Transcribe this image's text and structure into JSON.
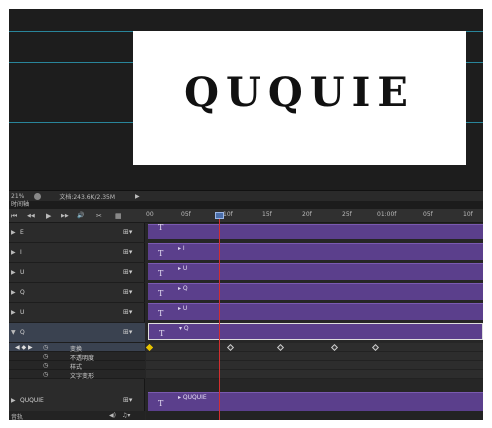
{
  "canvas": {
    "word": "QUQUIE"
  },
  "status": {
    "zoom": "21%",
    "doc_info": "文档:243.6K/2.35M"
  },
  "timeline": {
    "title": "时间轴",
    "controls": [
      "⏮",
      "◀◀",
      "▶",
      "▶▶",
      "🔊",
      "✂",
      "▦"
    ],
    "ticks": [
      "00",
      "05f",
      "10f",
      "15f",
      "20f",
      "25f",
      "01:00f",
      "05f",
      "10f"
    ]
  },
  "layers": [
    {
      "name": "E",
      "clip_label": ""
    },
    {
      "name": "I",
      "clip_label": "I"
    },
    {
      "name": "U",
      "clip_label": "U"
    },
    {
      "name": "Q",
      "clip_label": "Q"
    },
    {
      "name": "U",
      "clip_label": "U"
    },
    {
      "name": "Q",
      "clip_label": "Q",
      "expanded": true
    }
  ],
  "properties": [
    {
      "name": "变换",
      "keyframes": [
        0,
        0.24,
        0.39,
        0.55,
        0.67
      ]
    },
    {
      "name": "不透明度"
    },
    {
      "name": "样式"
    },
    {
      "name": "文字变形"
    }
  ],
  "group_layer": {
    "name": "QUQUIE",
    "clip_label": "QUQUIE"
  },
  "footer": {
    "label": "音轨"
  },
  "icons": {
    "film_icon": "film-icon",
    "text_icon": "T"
  }
}
